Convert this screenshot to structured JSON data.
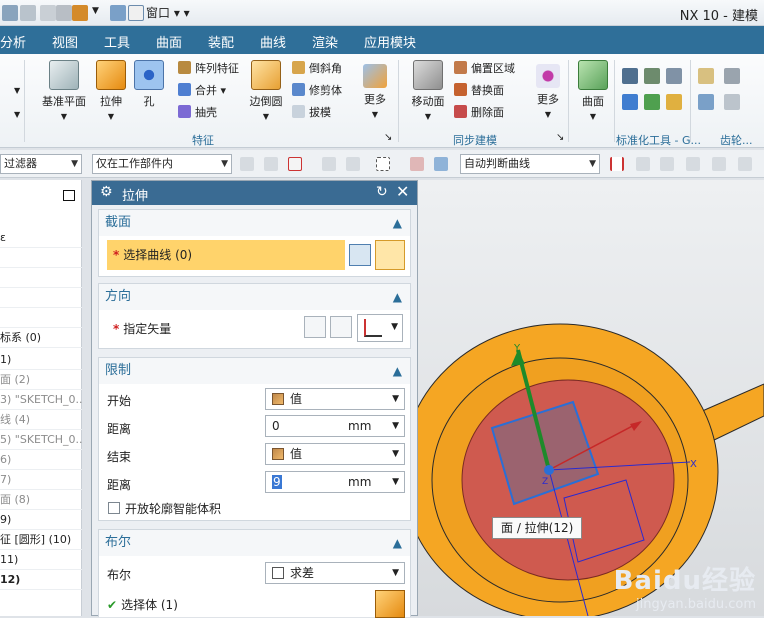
{
  "app": {
    "title": "NX 10 - 建模",
    "window_menu": "窗口"
  },
  "menu_tabs": [
    "分析",
    "视图",
    "工具",
    "曲面",
    "装配",
    "曲线",
    "渲染",
    "应用模块"
  ],
  "ribbon": {
    "datum_plane": "基准平面",
    "extrude": "拉伸",
    "hole": "孔",
    "pattern_feature": "阵列特征",
    "unite": "合并",
    "shell": "抽壳",
    "edge_blend": "边倒圆",
    "chamfer": "倒斜角",
    "trim_body": "修剪体",
    "draft": "拔模",
    "more1": "更多",
    "move_face": "移动面",
    "offset_region": "偏置区域",
    "replace_face": "替换面",
    "delete_face": "删除面",
    "more2": "更多",
    "surface": "曲面",
    "group_feature": "特征",
    "group_sync": "同步建模",
    "group_std": "标准化工具 - G...",
    "group_gear": "齿轮..."
  },
  "filterbar": {
    "filter": "过滤器",
    "scope": "仅在工作部件内",
    "curve_rule": "自动判断曲线"
  },
  "navigator": {
    "rows": [
      "ε",
      "",
      "",
      "",
      "",
      "",
      "标系 (0)",
      "1)",
      "面 (2)",
      "3) \"SKETCH_0...",
      "线 (4)",
      "5) \"SKETCH_0...",
      "6)",
      "7)",
      "面 (8)",
      "9)",
      "征 [圆形] (10)",
      "11)",
      "12)"
    ]
  },
  "dialog": {
    "title": "拉伸",
    "section_title": "截面",
    "select_curve": "选择曲线 (0)",
    "direction_title": "方向",
    "specify_vector": "指定矢量",
    "limits_title": "限制",
    "start_label": "开始",
    "start_value": "值",
    "distance_label": "距离",
    "start_distance": "0",
    "unit": "mm",
    "end_label": "结束",
    "end_value": "值",
    "end_distance": "9",
    "open_profile": "开放轮廓智能体积",
    "boolean_title": "布尔",
    "boolean_label": "布尔",
    "boolean_value": "求差",
    "select_body": "选择体 (1)"
  },
  "viewport": {
    "tooltip": "面 / 拉伸(12)",
    "axis_y": "Y",
    "axis_x": "X",
    "axis_z": "Z",
    "colors": {
      "orange": "#f5a623",
      "red_face": "#cf5a4f",
      "sel_blue": "#2a6fd6"
    }
  },
  "watermark": {
    "logo": "Baidu经验",
    "url": "jingyan.baidu.com"
  }
}
